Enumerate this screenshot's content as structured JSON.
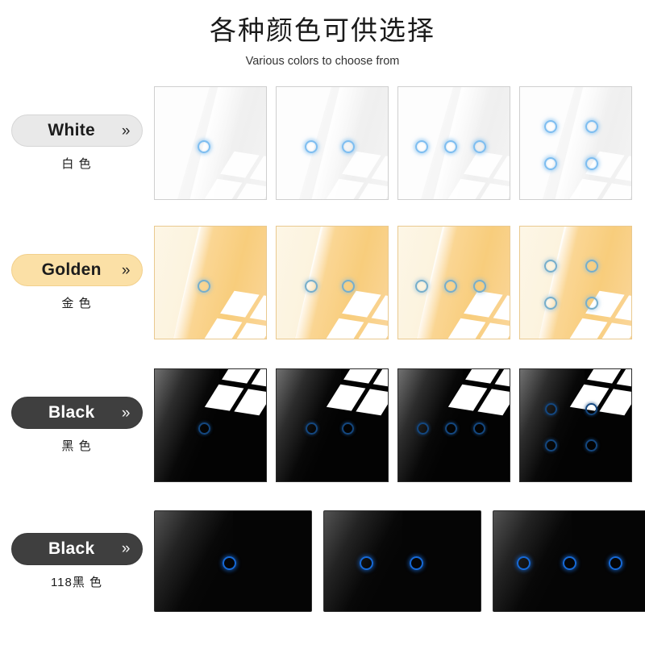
{
  "header": {
    "title_cn": "各种颜色可供选择",
    "subtitle_en": "Various colors to choose from"
  },
  "colors": {
    "white_pill_bg": "#e9e9e9",
    "gold_pill_bg": "#fbe0a6",
    "black_pill_bg": "#3f3f3f",
    "panel_white": "#f7f7f7",
    "panel_gold": "#f8cd7c",
    "panel_black": "#030303",
    "ring_light_blue": "#7dbdf0",
    "ring_gold_blue": "#76aecb",
    "ring_dark_blue": "#14477f",
    "ring_bright_blue": "#1669d6"
  },
  "rows": [
    {
      "id": "white",
      "label": "White",
      "chevron": "»",
      "sub_cn": "白 色",
      "pill_style": "pill-white",
      "panel_style": "p-white",
      "ring_style": "ring-light",
      "window_class": "window br win-light",
      "panel_shape": "panel-square",
      "strip_class": "panels-square",
      "panels": [
        {
          "gangs": 1,
          "name": "switch-panel-white-1gang"
        },
        {
          "gangs": 2,
          "name": "switch-panel-white-2gang"
        },
        {
          "gangs": 3,
          "name": "switch-panel-white-3gang"
        },
        {
          "gangs": 4,
          "name": "switch-panel-white-4gang"
        }
      ]
    },
    {
      "id": "golden",
      "label": "Golden",
      "chevron": "»",
      "sub_cn": "金 色",
      "pill_style": "pill-gold",
      "panel_style": "p-gold",
      "ring_style": "ring-gold",
      "window_class": "window br win-strong",
      "panel_shape": "panel-square",
      "strip_class": "panels-square",
      "panels": [
        {
          "gangs": 1,
          "name": "switch-panel-golden-1gang"
        },
        {
          "gangs": 2,
          "name": "switch-panel-golden-2gang"
        },
        {
          "gangs": 3,
          "name": "switch-panel-golden-3gang"
        },
        {
          "gangs": 4,
          "name": "switch-panel-golden-4gang"
        }
      ]
    },
    {
      "id": "black",
      "label": "Black",
      "chevron": "»",
      "sub_cn": "黑 色",
      "pill_style": "pill-black",
      "panel_style": "p-black",
      "ring_style": "ring-dark",
      "window_class": "window tr win-strong",
      "panel_shape": "panel-square",
      "strip_class": "panels-square",
      "panels": [
        {
          "gangs": 1,
          "name": "switch-panel-black-1gang"
        },
        {
          "gangs": 2,
          "name": "switch-panel-black-2gang"
        },
        {
          "gangs": 3,
          "name": "switch-panel-black-3gang"
        },
        {
          "gangs": 4,
          "name": "switch-panel-black-4gang"
        }
      ]
    },
    {
      "id": "black118",
      "label": "Black",
      "chevron": "»",
      "sub_cn": "118黑 色",
      "pill_style": "pill-black",
      "panel_style": "p-black118",
      "ring_style": "ring-bright",
      "window_class": "",
      "panel_shape": "panel-wide",
      "strip_class": "panels-wide",
      "panels": [
        {
          "gangs": 1,
          "name": "switch-panel-118black-1gang"
        },
        {
          "gangs": 2,
          "name": "switch-panel-118black-2gang"
        },
        {
          "gangs": 3,
          "name": "switch-panel-118black-3gang"
        }
      ]
    }
  ]
}
